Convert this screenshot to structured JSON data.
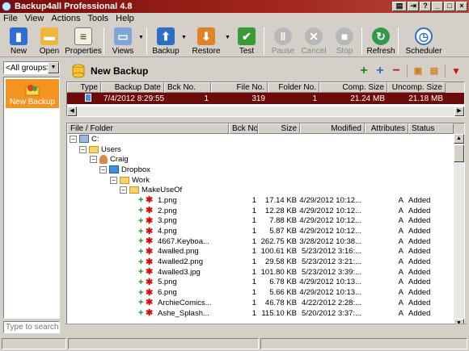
{
  "window": {
    "title": "Backup4all Professional 4.8"
  },
  "menu": [
    "File",
    "View",
    "Actions",
    "Tools",
    "Help"
  ],
  "toolbar": {
    "new": "New",
    "open": "Open",
    "properties": "Properties",
    "views": "Views",
    "backup": "Backup",
    "restore": "Restore",
    "test": "Test",
    "pause": "Pause",
    "cancel": "Cancel",
    "stop": "Stop",
    "refresh": "Refresh",
    "scheduler": "Scheduler"
  },
  "left": {
    "group_combo": "<All groups>",
    "group_item": "New Backup",
    "search_placeholder": "Type to search"
  },
  "backup_header": {
    "name": "New Backup"
  },
  "versions": {
    "columns": [
      "Type",
      "Backup Date",
      "Bck No.",
      "File No.",
      "Folder No.",
      "Comp. Size",
      "Uncomp. Size"
    ],
    "rows": [
      {
        "date": "7/4/2012 8:29:55 ...",
        "bck": "1",
        "files": "319",
        "folders": "1",
        "comp": "21.24 MB",
        "uncomp": "21.18 MB"
      }
    ]
  },
  "files": {
    "columns": [
      "File / Folder",
      "Bck No.",
      "Size",
      "Modified",
      "Attributes",
      "Status"
    ],
    "tree": [
      {
        "label": "C:",
        "kind": "drive"
      },
      {
        "label": "Users",
        "kind": "folder"
      },
      {
        "label": "Craig",
        "kind": "user"
      },
      {
        "label": "Dropbox",
        "kind": "dropbox"
      },
      {
        "label": "Work",
        "kind": "folder"
      },
      {
        "label": "MakeUseOf",
        "kind": "folder"
      }
    ],
    "rows": [
      {
        "name": "1.png",
        "bck": "1",
        "size": "17.14 KB",
        "mod": "4/29/2012 10:12...",
        "attr": "A",
        "status": "Added"
      },
      {
        "name": "2.png",
        "bck": "1",
        "size": "12.28 KB",
        "mod": "4/29/2012 10:12...",
        "attr": "A",
        "status": "Added"
      },
      {
        "name": "3.png",
        "bck": "1",
        "size": "7.88 KB",
        "mod": "4/29/2012 10:12...",
        "attr": "A",
        "status": "Added"
      },
      {
        "name": "4.png",
        "bck": "1",
        "size": "5.87 KB",
        "mod": "4/29/2012 10:12...",
        "attr": "A",
        "status": "Added"
      },
      {
        "name": "4667.Keyboa...",
        "bck": "1",
        "size": "262.75 KB",
        "mod": "3/28/2012 10:38...",
        "attr": "A",
        "status": "Added"
      },
      {
        "name": "4walled.png",
        "bck": "1",
        "size": "100.61 KB",
        "mod": "5/23/2012 3:16:...",
        "attr": "A",
        "status": "Added"
      },
      {
        "name": "4walled2.png",
        "bck": "1",
        "size": "29.58 KB",
        "mod": "5/23/2012 3:21:...",
        "attr": "A",
        "status": "Added"
      },
      {
        "name": "4walled3.jpg",
        "bck": "1",
        "size": "101.80 KB",
        "mod": "5/23/2012 3:39:...",
        "attr": "A",
        "status": "Added"
      },
      {
        "name": "5.png",
        "bck": "1",
        "size": "6.78 KB",
        "mod": "4/29/2012 10:13...",
        "attr": "A",
        "status": "Added"
      },
      {
        "name": "6.png",
        "bck": "1",
        "size": "5.66 KB",
        "mod": "4/29/2012 10:13...",
        "attr": "A",
        "status": "Added"
      },
      {
        "name": "ArchieComics...",
        "bck": "1",
        "size": "46.78 KB",
        "mod": "4/22/2012 2:28:...",
        "attr": "A",
        "status": "Added"
      },
      {
        "name": "Ashe_Splash...",
        "bck": "1",
        "size": "115.10 KB",
        "mod": "5/20/2012 3:37:...",
        "attr": "A",
        "status": "Added"
      }
    ]
  },
  "colors": {
    "title_bar": "#a2271d",
    "selected_row": "#6e0a0a",
    "group_item": "#f39322"
  }
}
